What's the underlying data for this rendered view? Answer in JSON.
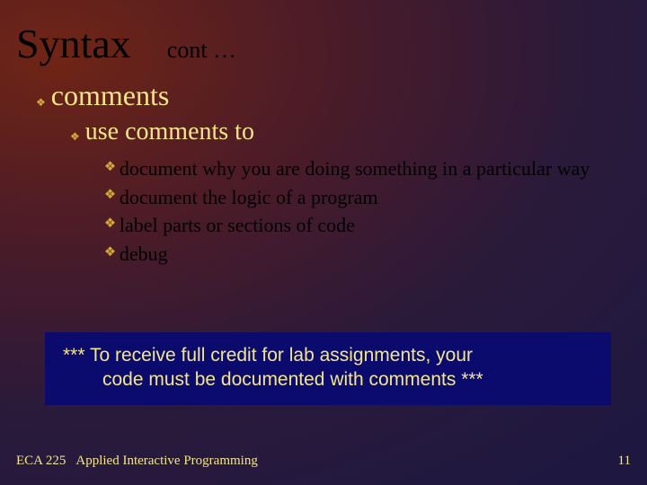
{
  "header": {
    "title": "Syntax",
    "continuation": "cont …"
  },
  "bullets": {
    "lvl1": "comments",
    "lvl2": "use comments to",
    "lvl3": [
      "document why you are doing something in a particular way",
      "document the logic of a program",
      "label parts or sections of code",
      "debug"
    ]
  },
  "note": {
    "line1": "*** To receive full credit for lab assignments, your",
    "line2": "code must be documented with comments ***"
  },
  "footer": {
    "course_code": "ECA 225",
    "course_name": "Applied Interactive Programming",
    "page_number": "11"
  },
  "colors": {
    "accent_text": "#f4e58a",
    "bullet": "#d4a93e",
    "note_bg": "#0b0b6e"
  }
}
